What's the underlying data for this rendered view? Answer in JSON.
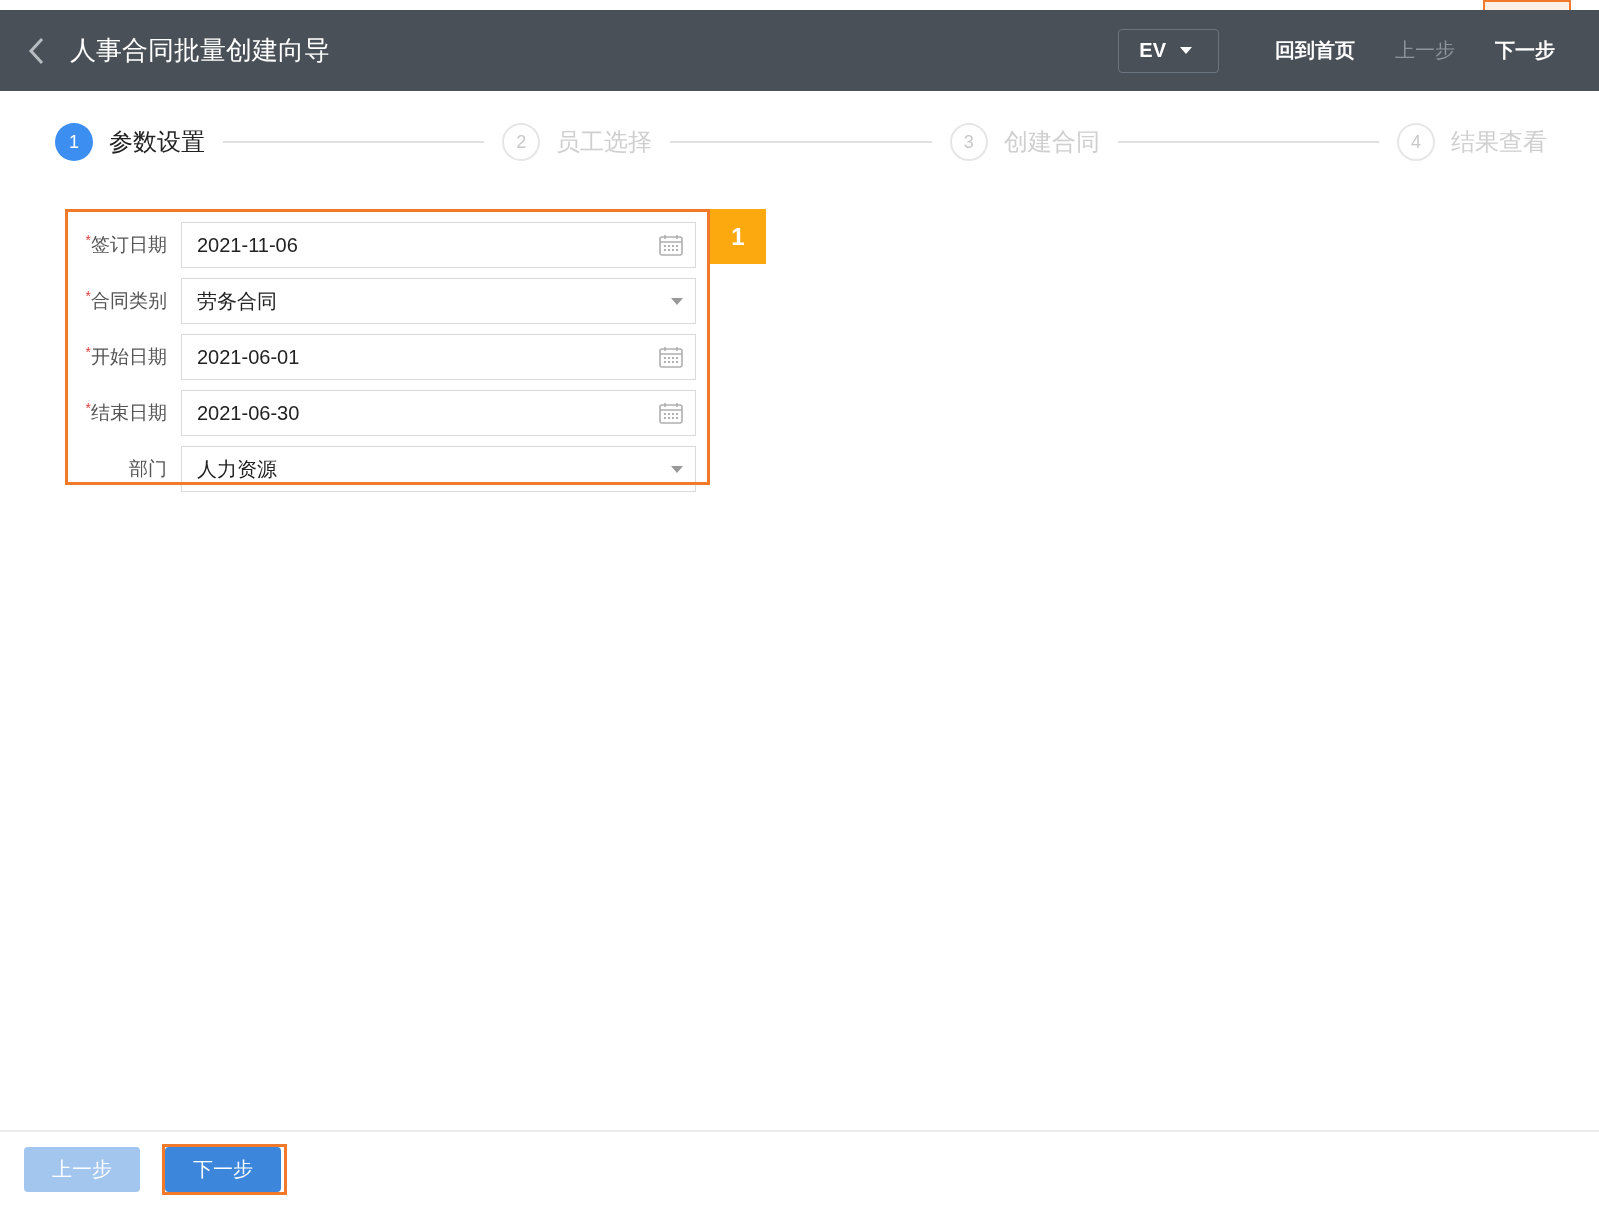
{
  "header": {
    "title": "人事合同批量创建向导",
    "language": "EV",
    "actions": [
      {
        "label": "回到首页",
        "disabled": false
      },
      {
        "label": "上一步",
        "disabled": true
      },
      {
        "label": "下一步",
        "disabled": false
      }
    ]
  },
  "steps": [
    {
      "number": "1",
      "label": "参数设置",
      "selected": true
    },
    {
      "number": "2",
      "label": "员工选择",
      "selected": false
    },
    {
      "number": "3",
      "label": "创建合同",
      "selected": false
    },
    {
      "number": "4",
      "label": "结果查看",
      "selected": false
    }
  ],
  "form": {
    "annotation": "1",
    "fields": [
      {
        "required_mark": "*",
        "label": "签订日期",
        "kind": "date",
        "value": "2021-11-06"
      },
      {
        "required_mark": "*",
        "label": "合同类别",
        "kind": "select",
        "value": "劳务合同"
      },
      {
        "required_mark": "*",
        "label": "开始日期",
        "kind": "date",
        "value": "2021-06-01"
      },
      {
        "required_mark": "*",
        "label": "结束日期",
        "kind": "date",
        "value": "2021-06-30"
      },
      {
        "label": "部门",
        "kind": "select",
        "value": "人力资源"
      }
    ]
  },
  "footer": {
    "buttons": [
      {
        "label": "上一步",
        "disabled": true
      },
      {
        "label": "下一步",
        "disabled": false,
        "highlighted": true
      }
    ]
  }
}
